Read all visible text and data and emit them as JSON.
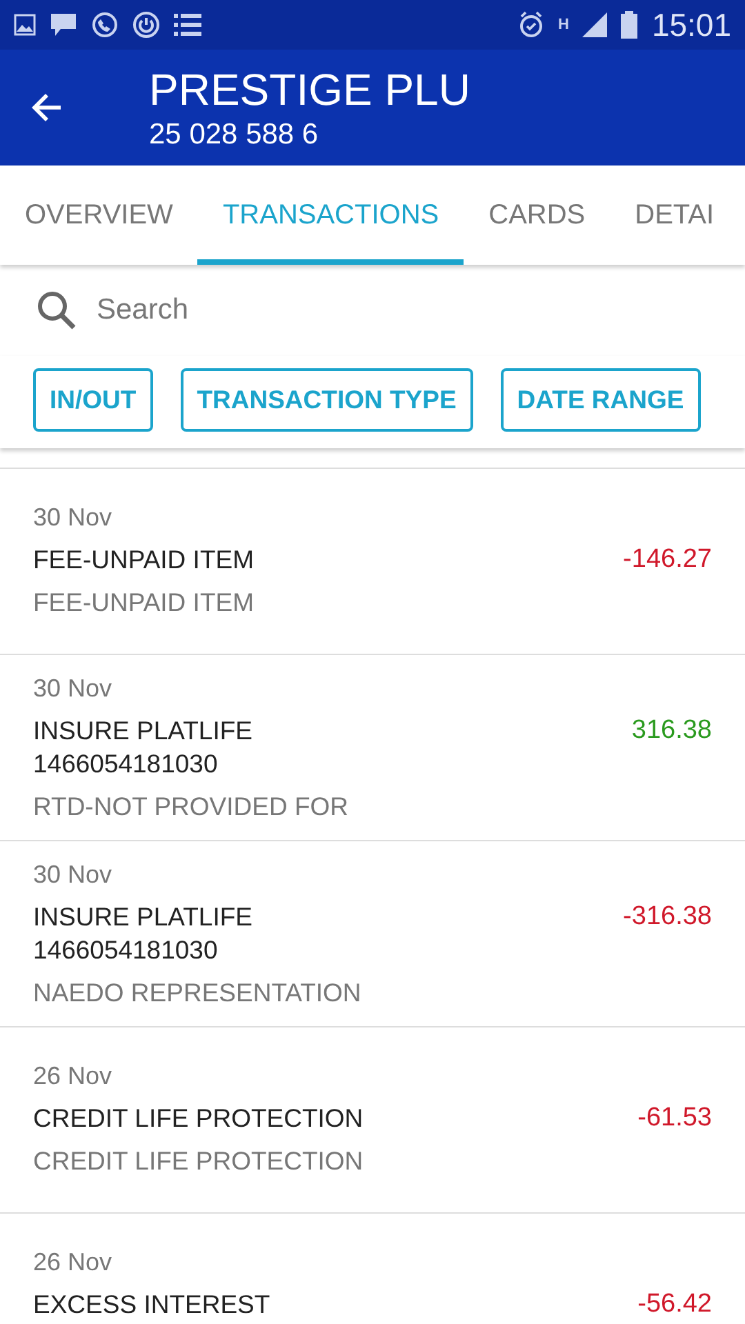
{
  "status_bar": {
    "time": "15:01",
    "network": "H"
  },
  "header": {
    "title": "PRESTIGE PLU",
    "account_number": "25 028 588 6"
  },
  "tabs": [
    {
      "label": "OVERVIEW",
      "selected": false
    },
    {
      "label": "TRANSACTIONS",
      "selected": true
    },
    {
      "label": "CARDS",
      "selected": false
    },
    {
      "label": "DETAI",
      "selected": false
    }
  ],
  "search": {
    "placeholder": "Search"
  },
  "filters": [
    "IN/OUT",
    "TRANSACTION TYPE",
    "DATE RANGE"
  ],
  "transactions": [
    {
      "date": "30 Nov",
      "description": [
        "FEE-UNPAID ITEM"
      ],
      "reference": "FEE-UNPAID ITEM",
      "amount": "-146.27",
      "color": "#d0182a"
    },
    {
      "date": "30 Nov",
      "description": [
        "INSURE PLATLIFE",
        "1466054181030"
      ],
      "reference": "RTD-NOT PROVIDED FOR",
      "amount": "316.38",
      "color": "#2a9a1e"
    },
    {
      "date": "30 Nov",
      "description": [
        "INSURE PLATLIFE",
        "1466054181030"
      ],
      "reference": "NAEDO REPRESENTATION",
      "amount": "-316.38",
      "color": "#d0182a"
    },
    {
      "date": "26 Nov",
      "description": [
        "CREDIT LIFE PROTECTION"
      ],
      "reference": "CREDIT LIFE PROTECTION",
      "amount": "-61.53",
      "color": "#d0182a"
    },
    {
      "date": "26 Nov",
      "description": [
        "EXCESS INTEREST"
      ],
      "amount": "-56.42",
      "color": "#d0182a"
    }
  ]
}
